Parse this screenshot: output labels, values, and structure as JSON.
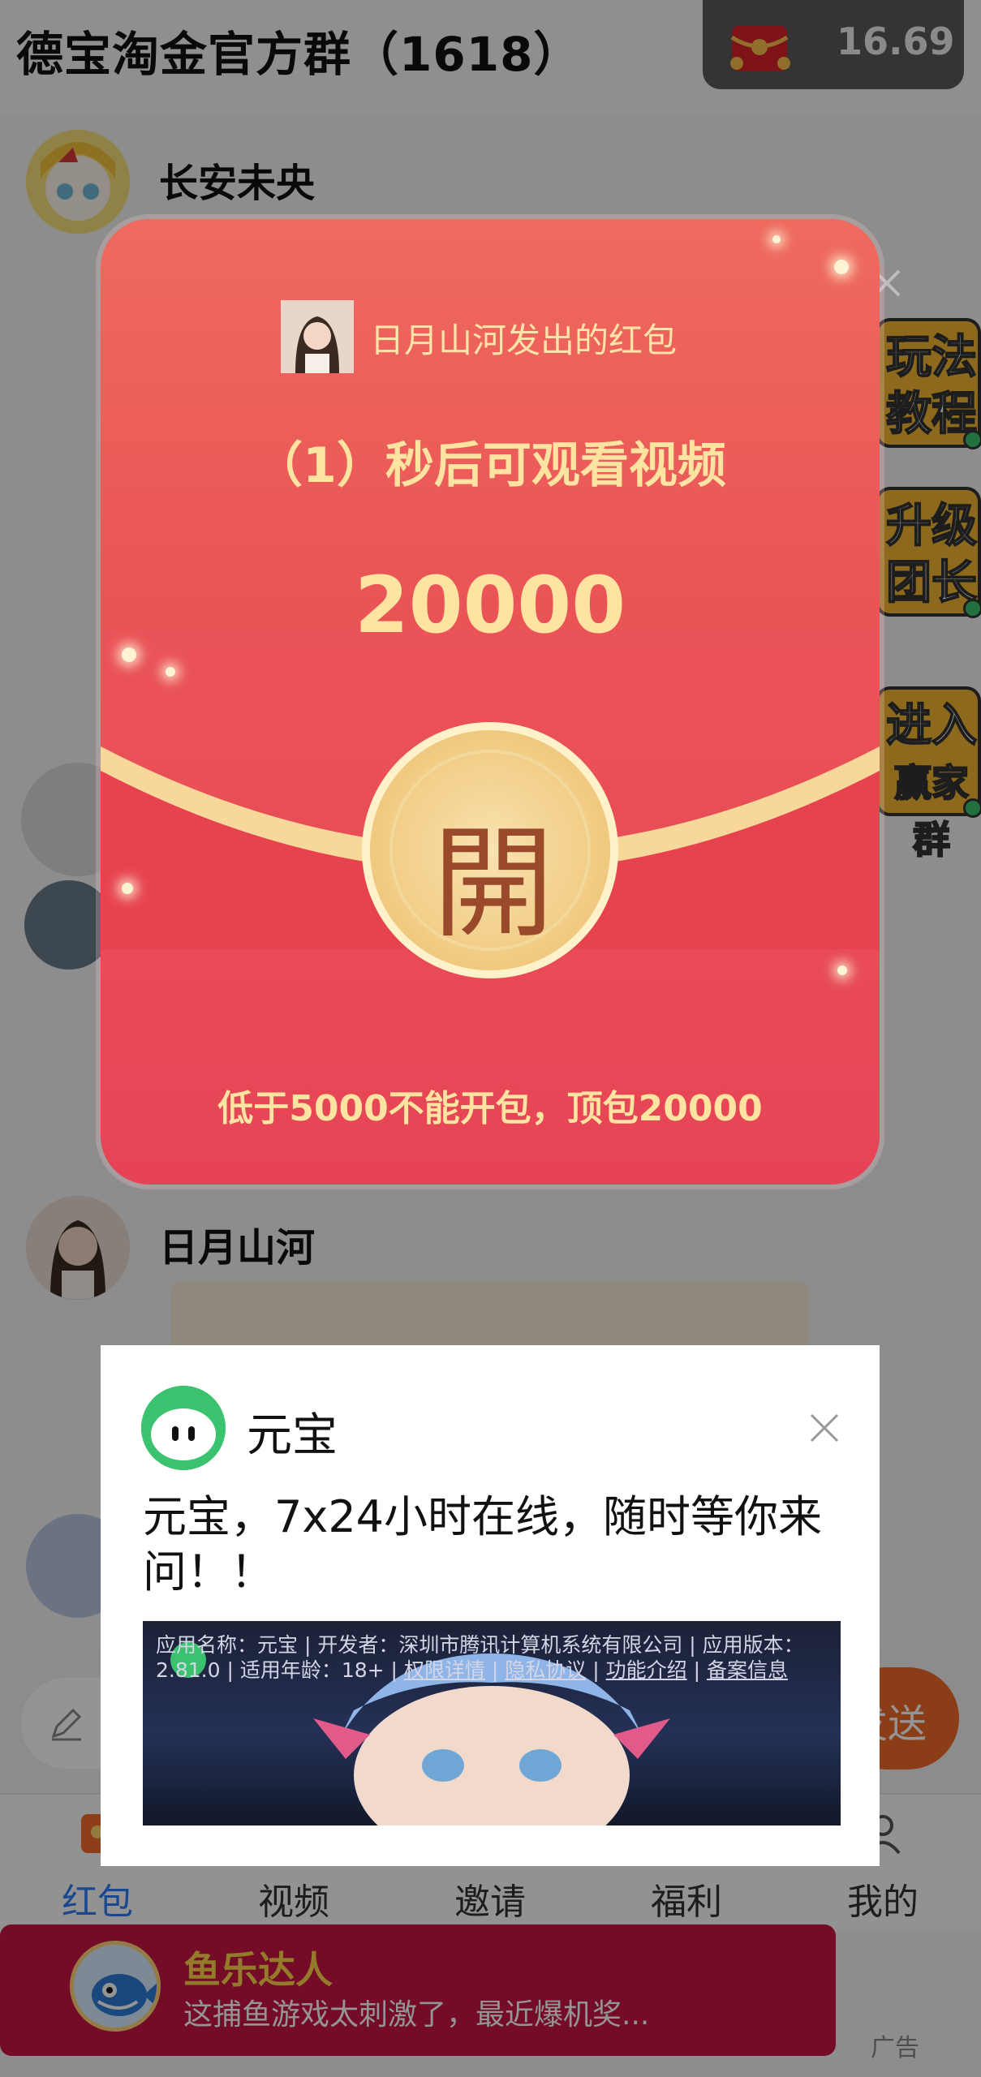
{
  "header": {
    "title": "德宝淘金官方群（1618）",
    "balance": "16.69",
    "balance_icon": "red-envelope-icon"
  },
  "chat": {
    "sender_1": "长安未央",
    "sender_2": "日月山河",
    "side_buttons": [
      {
        "label_line1": "玩法",
        "label_line2": "教程"
      },
      {
        "label_line1": "升级",
        "label_line2": "团长"
      },
      {
        "label_line1": "进入",
        "label_line2": "赢家群"
      }
    ]
  },
  "input": {
    "send_label": "发送"
  },
  "tabs": [
    {
      "label": "红包",
      "icon": "red-packet-icon",
      "active": true
    },
    {
      "label": "视频",
      "icon": "video-icon",
      "active": false
    },
    {
      "label": "邀请",
      "icon": "invite-icon",
      "active": false
    },
    {
      "label": "福利",
      "icon": "gift-icon",
      "active": false
    },
    {
      "label": "我的",
      "icon": "person-icon",
      "active": false
    }
  ],
  "banner_ad": {
    "title": "鱼乐达人",
    "description": "这捕鱼游戏太刺激了，最近爆机奖...",
    "tag": "广告"
  },
  "envelope": {
    "sender_text": "日月山河发出的红包",
    "countdown": "（1）秒后可观看视频",
    "amount": "20000",
    "open_label": "開",
    "footer": "低于5000不能开包，顶包20000",
    "colors": {
      "body": "#e64456",
      "gold": "#ffe3a0"
    }
  },
  "ad_dialog": {
    "app_name": "元宝",
    "headline": "元宝，7x24小时在线，随时等你来问！！",
    "disclaimer_prefix": "应用名称：元宝 | 开发者：深圳市腾讯计算机系统有限公司 | 应用版本：2.81.0 | 适用年龄：18+ | ",
    "links": [
      "权限详情",
      "隐私协议",
      "功能介绍",
      "备案信息"
    ]
  }
}
